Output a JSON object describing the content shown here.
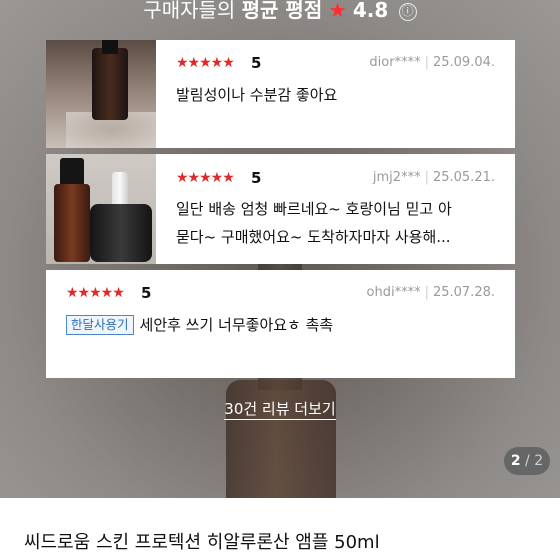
{
  "rating_header": {
    "prefix": "구매자들의",
    "label": "평균 평점",
    "star": "★",
    "score": "4.8",
    "info_icon": "ⓘ"
  },
  "reviews": [
    {
      "stars": "★★★★★",
      "score": "5",
      "user": "dior****",
      "date": "25.09.04.",
      "text_line1": "발림성이나 수분감 좋아요",
      "text_line2": "",
      "has_photo": true
    },
    {
      "stars": "★★★★★",
      "score": "5",
      "user": "jmj2***",
      "date": "25.05.21.",
      "text_line1": "일단 배송 엄청 빠르네요~ 호랑이님 믿고 아",
      "text_line2": "묻다~ 구매했어요~ 도착하자마자 사용해...",
      "has_photo": true
    },
    {
      "stars": "★★★★★",
      "score": "5",
      "user": "ohdi****",
      "date": "25.07.28.",
      "tag": "한달사용기",
      "text_line1": "세안후 쓰기 너무좋아요ㅎ 촉촉",
      "has_photo": false
    }
  ],
  "more_reviews_link": "30건 리뷰 더보기",
  "pager": {
    "current": "2",
    "separator": "/",
    "total": "2"
  },
  "product_title": "씨드로움 스킨 프로텍션 히알루론산 앰플 50ml",
  "colors": {
    "accent_red": "#e02a2a",
    "tag_blue": "#2f6fb8"
  }
}
